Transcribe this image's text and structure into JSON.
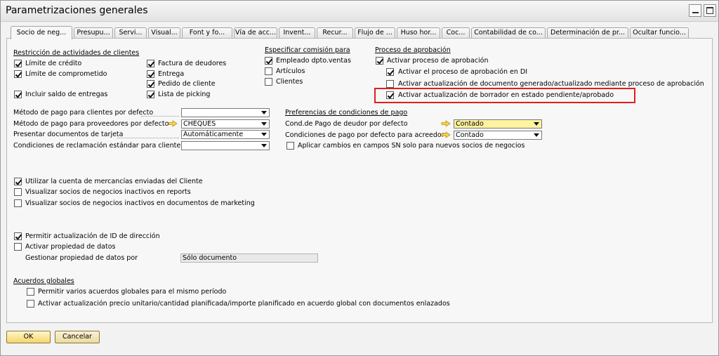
{
  "window": {
    "title": "Parametrizaciones generales"
  },
  "tabs": [
    "Socio de neg...",
    "Presupu...",
    "Servi...",
    "Visual...",
    "Font y fo...",
    "Vía de acc...",
    "Invent...",
    "Recur...",
    "Flujo de ...",
    "Huso hor...",
    "Coc...",
    "Contabilidad de co...",
    "Determinación de pr...",
    "Ocultar funcio..."
  ],
  "restriccion": {
    "header": "Restricción de actividades de clientes",
    "limite_credito": "Límite de crédito",
    "limite_comprometido": "Límite de comprometido",
    "incluir_saldo": "Incluir saldo de entregas",
    "factura_deudores": "Factura de deudores",
    "entrega": "Entrega",
    "pedido_cliente": "Pedido de cliente",
    "lista_picking": "Lista de picking"
  },
  "comision": {
    "header": "Especificar comisión para",
    "empleado": "Empleado dpto.ventas",
    "articulos": "Artículos",
    "clientes": "Clientes"
  },
  "aprobacion": {
    "header": "Proceso de aprobación",
    "activar_proceso": "Activar proceso de aprobación",
    "activar_di": "Activar el proceso de aprobación en DI",
    "activar_actualizacion_doc": "Activar actualización de documento generado/actualizado mediante proceso de aprobación",
    "activar_borrador": "Activar actualización de borrador en estado pendiente/aprobado"
  },
  "pagos": {
    "metodo_clientes_label": "Método de pago para clientes por defecto",
    "metodo_clientes_value": "",
    "metodo_proveedores_label": "Método de pago para proveedores por defecto",
    "metodo_proveedores_value": "CHEQUES",
    "presentar_tarjeta_label": "Presentar documentos de tarjeta",
    "presentar_tarjeta_value": "Automáticamente",
    "condiciones_reclamacion_label": "Condiciones de reclamación estándar para cliente",
    "condiciones_reclamacion_value": ""
  },
  "preferencias": {
    "header": "Preferencias de condiciones de pago",
    "cond_deudor_label": "Cond.de Pago de deudor por defecto",
    "cond_deudor_value": "Contado",
    "cond_acreedor_label": "Condiciones de pago por defecto para acreedor",
    "cond_acreedor_value": "Contado",
    "aplicar_cambios": "Aplicar cambios en campos SN solo para nuevos socios de negocios"
  },
  "otros": {
    "utilizar_cuenta": "Utilizar la cuenta de mercancías enviadas del Cliente",
    "visualizar_reports": "Visualizar socios de negocios inactivos en reports",
    "visualizar_marketing": "Visualizar socios de negocios inactivos en documentos de marketing",
    "permitir_id_direccion": "Permitir actualización de ID de dirección",
    "activar_propiedad": "Activar propiedad de datos",
    "gestionar_propiedad_label": "Gestionar propiedad de datos por",
    "gestionar_propiedad_value": "Sólo documento"
  },
  "acuerdos": {
    "header": "Acuerdos globales",
    "permitir_varios": "Permitir varios acuerdos globales para el mismo período",
    "activar_precio": "Activar actualización precio unitario/cantidad planificada/importe planificado en acuerdo global con documentos enlazados"
  },
  "buttons": {
    "ok": "OK",
    "cancel": "Cancelar"
  },
  "colors": {
    "highlight": "#e01e1e",
    "yellow_field": "#fff3a0",
    "button": "#f5d66a"
  }
}
